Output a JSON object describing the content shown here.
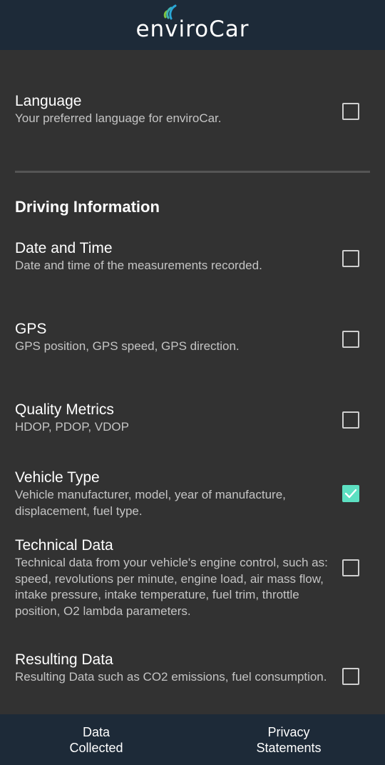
{
  "app": {
    "logo_text": "enviroCar",
    "accent_color": "#5de0c2",
    "topbar_color": "#1d2a38",
    "background_color": "#323232"
  },
  "settings": {
    "language": {
      "title": "Language",
      "description": "Your preferred language for enviroCar.",
      "checked": false
    },
    "section_header": "Driving Information",
    "items": [
      {
        "title": "Date and Time",
        "description": "Date and time of the measurements recorded.",
        "checked": false
      },
      {
        "title": "GPS",
        "description": "GPS position, GPS speed, GPS direction.",
        "checked": false
      },
      {
        "title": "Quality Metrics",
        "description": "HDOP, PDOP, VDOP",
        "checked": false
      },
      {
        "title": "Vehicle Type",
        "description": "Vehicle manufacturer, model, year of manufacture, displacement, fuel type.",
        "checked": true
      },
      {
        "title": "Technical Data",
        "description": "Technical data from your vehicle's engine control, such as: speed, revolutions per minute, engine load, air mass flow, intake pressure, intake temperature, fuel trim, throttle position, O2 lambda parameters.",
        "checked": false
      },
      {
        "title": "Resulting Data",
        "description": "Resulting Data such as CO2 emissions, fuel consumption.",
        "checked": false
      }
    ]
  },
  "bottom_nav": {
    "data_collected": "Data\nCollected",
    "privacy_statements": "Privacy\nStatements"
  }
}
